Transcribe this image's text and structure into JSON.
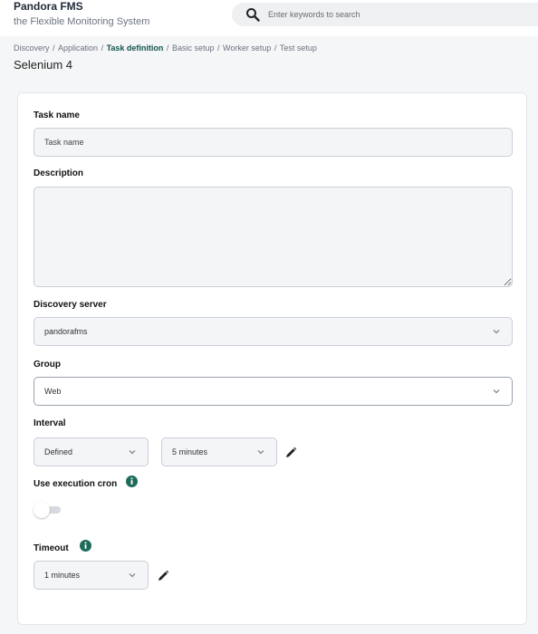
{
  "header": {
    "app_name": "Pandora FMS",
    "tagline": "the Flexible Monitoring System",
    "search_placeholder": "Enter keywords to search"
  },
  "breadcrumb": {
    "items": [
      "Discovery",
      "Application",
      "Task definition",
      "Basic setup",
      "Worker setup",
      "Test setup"
    ],
    "active": "Task definition"
  },
  "page_title": "Selenium 4",
  "form": {
    "task_name_label": "Task name",
    "task_name_placeholder": "Task name",
    "description_label": "Description",
    "description_value": "",
    "discovery_server_label": "Discovery server",
    "discovery_server_value": "pandorafms",
    "group_label": "Group",
    "group_value": "Web",
    "interval_label": "Interval",
    "interval_mode_value": "Defined",
    "interval_value": "5 minutes",
    "use_exec_cron_label": "Use execution cron",
    "use_exec_cron_enabled": false,
    "timeout_label": "Timeout",
    "timeout_value": "1 minutes"
  },
  "colors": {
    "accent": "#14524f",
    "info_icon": "#1e6b5a"
  }
}
